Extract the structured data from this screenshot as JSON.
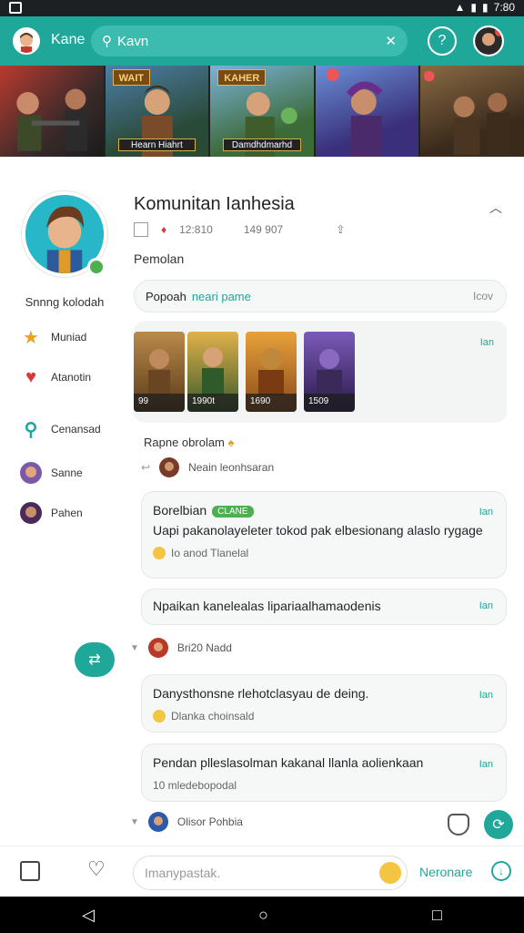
{
  "status": {
    "time": "7:80"
  },
  "topbar": {
    "app_name": "Kane",
    "search_value": "Kavn",
    "icons": [
      "profile-avatar-icon",
      "search-icon",
      "clear-icon",
      "help-icon",
      "user-avatar-icon"
    ]
  },
  "banner": {
    "tiles": [
      {
        "caption": ""
      },
      {
        "top": "WAIT",
        "caption": "Hearn Hiahrt"
      },
      {
        "top": "KAHER",
        "caption": "Damdhdmarhd"
      },
      {
        "caption": ""
      },
      {
        "caption": ""
      }
    ]
  },
  "sidebar": {
    "username": "Snnng kolodah",
    "items": [
      {
        "label": "Muniad",
        "icon": "star-icon"
      },
      {
        "label": "Atanotin",
        "icon": "heart-gem-icon"
      },
      {
        "label": "Cenansad",
        "icon": "search-people-icon"
      },
      {
        "label": "Sanne",
        "icon": "avatar"
      },
      {
        "label": "Pahen",
        "icon": "avatar"
      }
    ],
    "fab_label": "⇄"
  },
  "community": {
    "title": "Komunitan Ianhesia",
    "stats": [
      "12:810",
      "149 907"
    ],
    "description": "Pemolan",
    "pinned_label": "Popoah",
    "pinned_highlight": "neari pame",
    "pinned_time": "Icov",
    "gallery_time": "Ian",
    "gallery": [
      {
        "label": "99",
        "color": "#8a5b2a"
      },
      {
        "label": "1990t",
        "color": "#c98e2a"
      },
      {
        "label": "1690",
        "color": "#d69a2e"
      },
      {
        "label": "1509",
        "color": "#5b3b78"
      }
    ]
  },
  "thread": {
    "caption": "Rapne obrolam",
    "reply_to": "Neain leonhsaran",
    "messages": [
      {
        "title": "Borelbian",
        "badge": "CLANE",
        "body": "Uapi pakanolayeleter tokod pak elbesionang alaslo rygage",
        "sub": "Io anod Tlanelal",
        "time": "Ian"
      },
      {
        "title": "Npaikan kanelealas lipariaalhamaodenis",
        "time": "Ian"
      }
    ],
    "sender2": "Bri20 Nadd",
    "messages2": [
      {
        "title": "Danysthonsne rlehotclasyau de deing.",
        "sub": "Dlanka choinsald",
        "time": "Ian"
      },
      {
        "title": "Pendan plleslasolman kakanal llanla aolienkaan",
        "sub": "10 mledebopodal",
        "time": "Ian"
      }
    ],
    "sender3": "Olisor Pohbia"
  },
  "composer": {
    "placeholder": "Imanypastak.",
    "send_label": "Neronare"
  }
}
